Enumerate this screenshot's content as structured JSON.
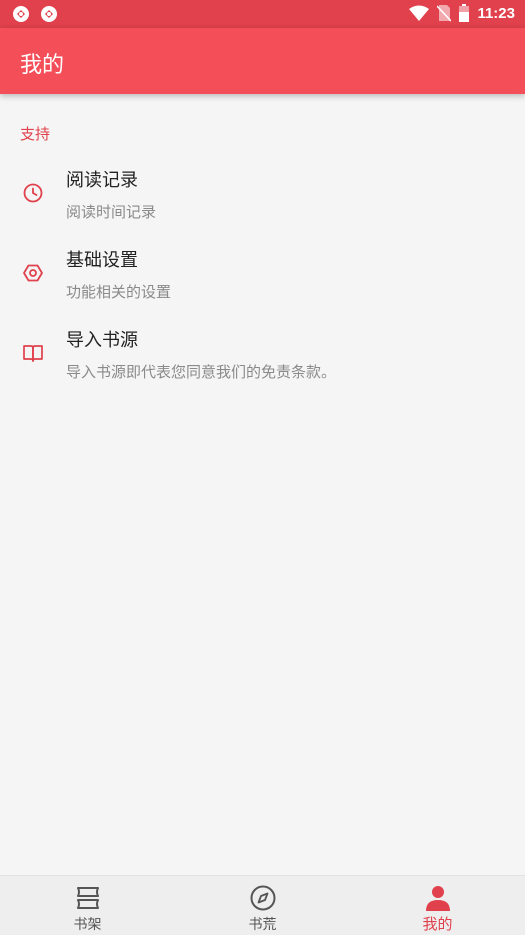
{
  "status_bar": {
    "time": "11:23",
    "left_icons": [
      "app-notification-icon",
      "app-notification-icon"
    ],
    "right_icons": [
      "wifi-icon",
      "no-sim-icon",
      "battery-icon"
    ]
  },
  "app_bar": {
    "title": "我的"
  },
  "section": {
    "title": "支持",
    "items": [
      {
        "title": "阅读记录",
        "subtitle": "阅读时间记录",
        "icon": "clock-icon"
      },
      {
        "title": "基础设置",
        "subtitle": "功能相关的设置",
        "icon": "settings-icon"
      },
      {
        "title": "导入书源",
        "subtitle": "导入书源即代表您同意我们的免责条款。",
        "icon": "book-icon"
      }
    ]
  },
  "bottom_nav": {
    "items": [
      {
        "label": "书架",
        "icon": "bookshelf-icon",
        "active": false
      },
      {
        "label": "书荒",
        "icon": "compass-icon",
        "active": false
      },
      {
        "label": "我的",
        "icon": "person-icon",
        "active": true
      }
    ]
  },
  "colors": {
    "status_bar": "#e0414c",
    "app_bar": "#f44e58",
    "accent": "#e0414c",
    "background": "#f5f5f5"
  }
}
